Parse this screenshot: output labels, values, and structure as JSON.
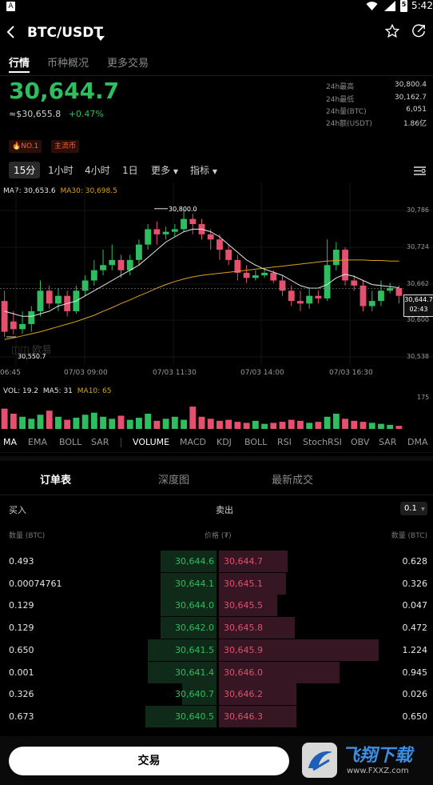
{
  "statusbar": {
    "time": "5:42",
    "app_badge": "A",
    "battery_badge": "5"
  },
  "header": {
    "pair": "BTC/USDT"
  },
  "tabs": [
    {
      "label": "行情"
    },
    {
      "label": "币种概况"
    },
    {
      "label": "更多交易"
    }
  ],
  "price": {
    "last": "30,644.7",
    "usd": "≈$30,655.8",
    "change": "+0.47%"
  },
  "stats": [
    {
      "label": "24h最高",
      "value": "30,800.4"
    },
    {
      "label": "24h最低",
      "value": "30,162.7"
    },
    {
      "label": "24h量(BTC)",
      "value": "6,051"
    },
    {
      "label": "24h额(USDT)",
      "value": "1.86亿"
    }
  ],
  "tags": [
    {
      "label": "NO.1"
    },
    {
      "label": "主流币"
    }
  ],
  "intervals": [
    {
      "label": "15分"
    },
    {
      "label": "1小时"
    },
    {
      "label": "4小时"
    },
    {
      "label": "1日"
    },
    {
      "label": "更多"
    },
    {
      "label": "指标"
    }
  ],
  "chart": {
    "ma_info": {
      "ma7": "MA7: 30,653.6",
      "ma30": "MA30: 30,698.5"
    },
    "high_marker": "30,800.0",
    "low_marker": "30,550.7",
    "y_ticks": [
      "30,786",
      "30,724",
      "30,662",
      "30,600",
      "30,538"
    ],
    "x_ticks": [
      "06:45",
      "07/03 09:00",
      "07/03 11:30",
      "07/03 14:00",
      "07/03 16:30"
    ],
    "current_price": "30,644.7",
    "countdown": "02:43",
    "watermark": "欧易",
    "vol_info": {
      "vol": "VOL: 19.2",
      "ma5": "MA5: 31",
      "ma10": "MA10: 65"
    },
    "vol_tick": "175",
    "colors": {
      "up": "#2ebd5f",
      "down": "#e4506e",
      "ma7": "#e6e6e6",
      "ma30": "#d8a21c"
    }
  },
  "chart_data": {
    "type": "candlestick",
    "y_range": [
      30500,
      30820
    ],
    "candles": [
      [
        30620,
        30560,
        30640,
        30550
      ],
      [
        30580,
        30565,
        30600,
        30555
      ],
      [
        30565,
        30575,
        30600,
        30556
      ],
      [
        30575,
        30600,
        30610,
        30560
      ],
      [
        30600,
        30640,
        30660,
        30590
      ],
      [
        30640,
        30615,
        30650,
        30605
      ],
      [
        30615,
        30630,
        30645,
        30600
      ],
      [
        30630,
        30600,
        30640,
        30590
      ],
      [
        30600,
        30640,
        30650,
        30595
      ],
      [
        30640,
        30660,
        30670,
        30630
      ],
      [
        30660,
        30680,
        30700,
        30650
      ],
      [
        30680,
        30690,
        30720,
        30670
      ],
      [
        30690,
        30700,
        30730,
        30680
      ],
      [
        30700,
        30680,
        30710,
        30665
      ],
      [
        30680,
        30700,
        30710,
        30670
      ],
      [
        30700,
        30730,
        30740,
        30690
      ],
      [
        30730,
        30760,
        30770,
        30720
      ],
      [
        30760,
        30750,
        30775,
        30730
      ],
      [
        30750,
        30755,
        30765,
        30740
      ],
      [
        30755,
        30760,
        30770,
        30745
      ],
      [
        30760,
        30780,
        30800,
        30755
      ],
      [
        30780,
        30770,
        30790,
        30750
      ],
      [
        30770,
        30750,
        30780,
        30740
      ],
      [
        30750,
        30740,
        30760,
        30720
      ],
      [
        30740,
        30720,
        30750,
        30700
      ],
      [
        30720,
        30700,
        30730,
        30690
      ],
      [
        30700,
        30675,
        30710,
        30660
      ],
      [
        30675,
        30665,
        30690,
        30655
      ],
      [
        30665,
        30670,
        30680,
        30660
      ],
      [
        30670,
        30675,
        30685,
        30665
      ],
      [
        30675,
        30660,
        30680,
        30655
      ],
      [
        30660,
        30640,
        30670,
        30630
      ],
      [
        30640,
        30620,
        30650,
        30610
      ],
      [
        30620,
        30615,
        30640,
        30600
      ],
      [
        30615,
        30630,
        30645,
        30605
      ],
      [
        30630,
        30625,
        30640,
        30615
      ],
      [
        30625,
        30690,
        30740,
        30620
      ],
      [
        30690,
        30720,
        30735,
        30680
      ],
      [
        30720,
        30660,
        30725,
        30650
      ],
      [
        30660,
        30650,
        30670,
        30640
      ],
      [
        30650,
        30610,
        30660,
        30600
      ],
      [
        30610,
        30620,
        30640,
        30600
      ],
      [
        30620,
        30640,
        30660,
        30610
      ],
      [
        30640,
        30645,
        30655,
        30635
      ],
      [
        30645,
        30630,
        30650,
        30615
      ]
    ],
    "volumes": [
      20,
      15,
      12,
      10,
      14,
      18,
      12,
      9,
      11,
      14,
      16,
      12,
      10,
      13,
      9,
      11,
      15,
      8,
      10,
      12,
      9,
      22,
      12,
      10,
      8,
      9,
      7,
      6,
      8,
      5,
      6,
      7,
      9,
      8,
      6,
      7,
      12,
      15,
      10,
      8,
      7,
      6,
      5,
      4,
      3
    ],
    "ma7": [
      30600,
      30595,
      30590,
      30590,
      30595,
      30600,
      30610,
      30615,
      30620,
      30630,
      30640,
      30650,
      30660,
      30670,
      30680,
      30690,
      30705,
      30720,
      30735,
      30745,
      30755,
      30760,
      30760,
      30755,
      30745,
      30730,
      30715,
      30700,
      30690,
      30682,
      30676,
      30670,
      30660,
      30650,
      30645,
      30645,
      30652,
      30665,
      30672,
      30668,
      30660,
      30652,
      30650,
      30648,
      30646
    ],
    "ma30": [
      30545,
      30548,
      30552,
      30556,
      30560,
      30565,
      30570,
      30575,
      30580,
      30586,
      30592,
      30600,
      30607,
      30615,
      30622,
      30630,
      30637,
      30645,
      30652,
      30658,
      30663,
      30667,
      30670,
      30672,
      30674,
      30676,
      30678,
      30680,
      30682,
      30684,
      30686,
      30688,
      30690,
      30692,
      30694,
      30696,
      30698,
      30699,
      30700,
      30700,
      30700,
      30699,
      30699,
      30698,
      30698
    ]
  },
  "indicators": [
    "MA",
    "EMA",
    "BOLL",
    "SAR",
    "VOLUME",
    "MACD",
    "KDJ",
    "BOLL",
    "RSI",
    "StochRSI",
    "OBV",
    "SAR",
    "DMA"
  ],
  "orderbook": {
    "tabs": [
      "订单表",
      "深度图",
      "最新成交"
    ],
    "buy_label": "买入",
    "sell_label": "卖出",
    "precision": "0.1",
    "col_qty_left": "数量 (BTC)",
    "col_price": "价格 (₮)",
    "col_qty_right": "数量 (BTC)",
    "rows": [
      {
        "bid_qty": "0.493",
        "bid": "30,644.6",
        "ask": "30,644.7",
        "ask_qty": "0.628",
        "bid_depth": 0.26,
        "ask_depth": 0.32
      },
      {
        "bid_qty": "0.00074761",
        "bid": "30,644.1",
        "ask": "30,645.1",
        "ask_qty": "0.326",
        "bid_depth": 0.26,
        "ask_depth": 0.31
      },
      {
        "bid_qty": "0.129",
        "bid": "30,644.0",
        "ask": "30,645.5",
        "ask_qty": "0.047",
        "bid_depth": 0.26,
        "ask_depth": 0.27
      },
      {
        "bid_qty": "0.129",
        "bid": "30,642.0",
        "ask": "30,645.8",
        "ask_qty": "0.472",
        "bid_depth": 0.26,
        "ask_depth": 0.35
      },
      {
        "bid_qty": "0.650",
        "bid": "30,641.5",
        "ask": "30,645.9",
        "ask_qty": "1.224",
        "bid_depth": 0.32,
        "ask_depth": 0.74
      },
      {
        "bid_qty": "0.001",
        "bid": "30,641.4",
        "ask": "30,646.0",
        "ask_qty": "0.945",
        "bid_depth": 0.32,
        "ask_depth": 0.56
      },
      {
        "bid_qty": "0.326",
        "bid": "30,640.7",
        "ask": "30,646.2",
        "ask_qty": "0.026",
        "bid_depth": 0.16,
        "ask_depth": 0.36
      },
      {
        "bid_qty": "0.673",
        "bid": "30,640.5",
        "ask": "30,646.3",
        "ask_qty": "0.650",
        "bid_depth": 0.33,
        "ask_depth": 0.36
      }
    ]
  },
  "trade_button": "交易",
  "watermark_brand": "飞翔下载",
  "watermark_url": "www.FXXZ.com"
}
